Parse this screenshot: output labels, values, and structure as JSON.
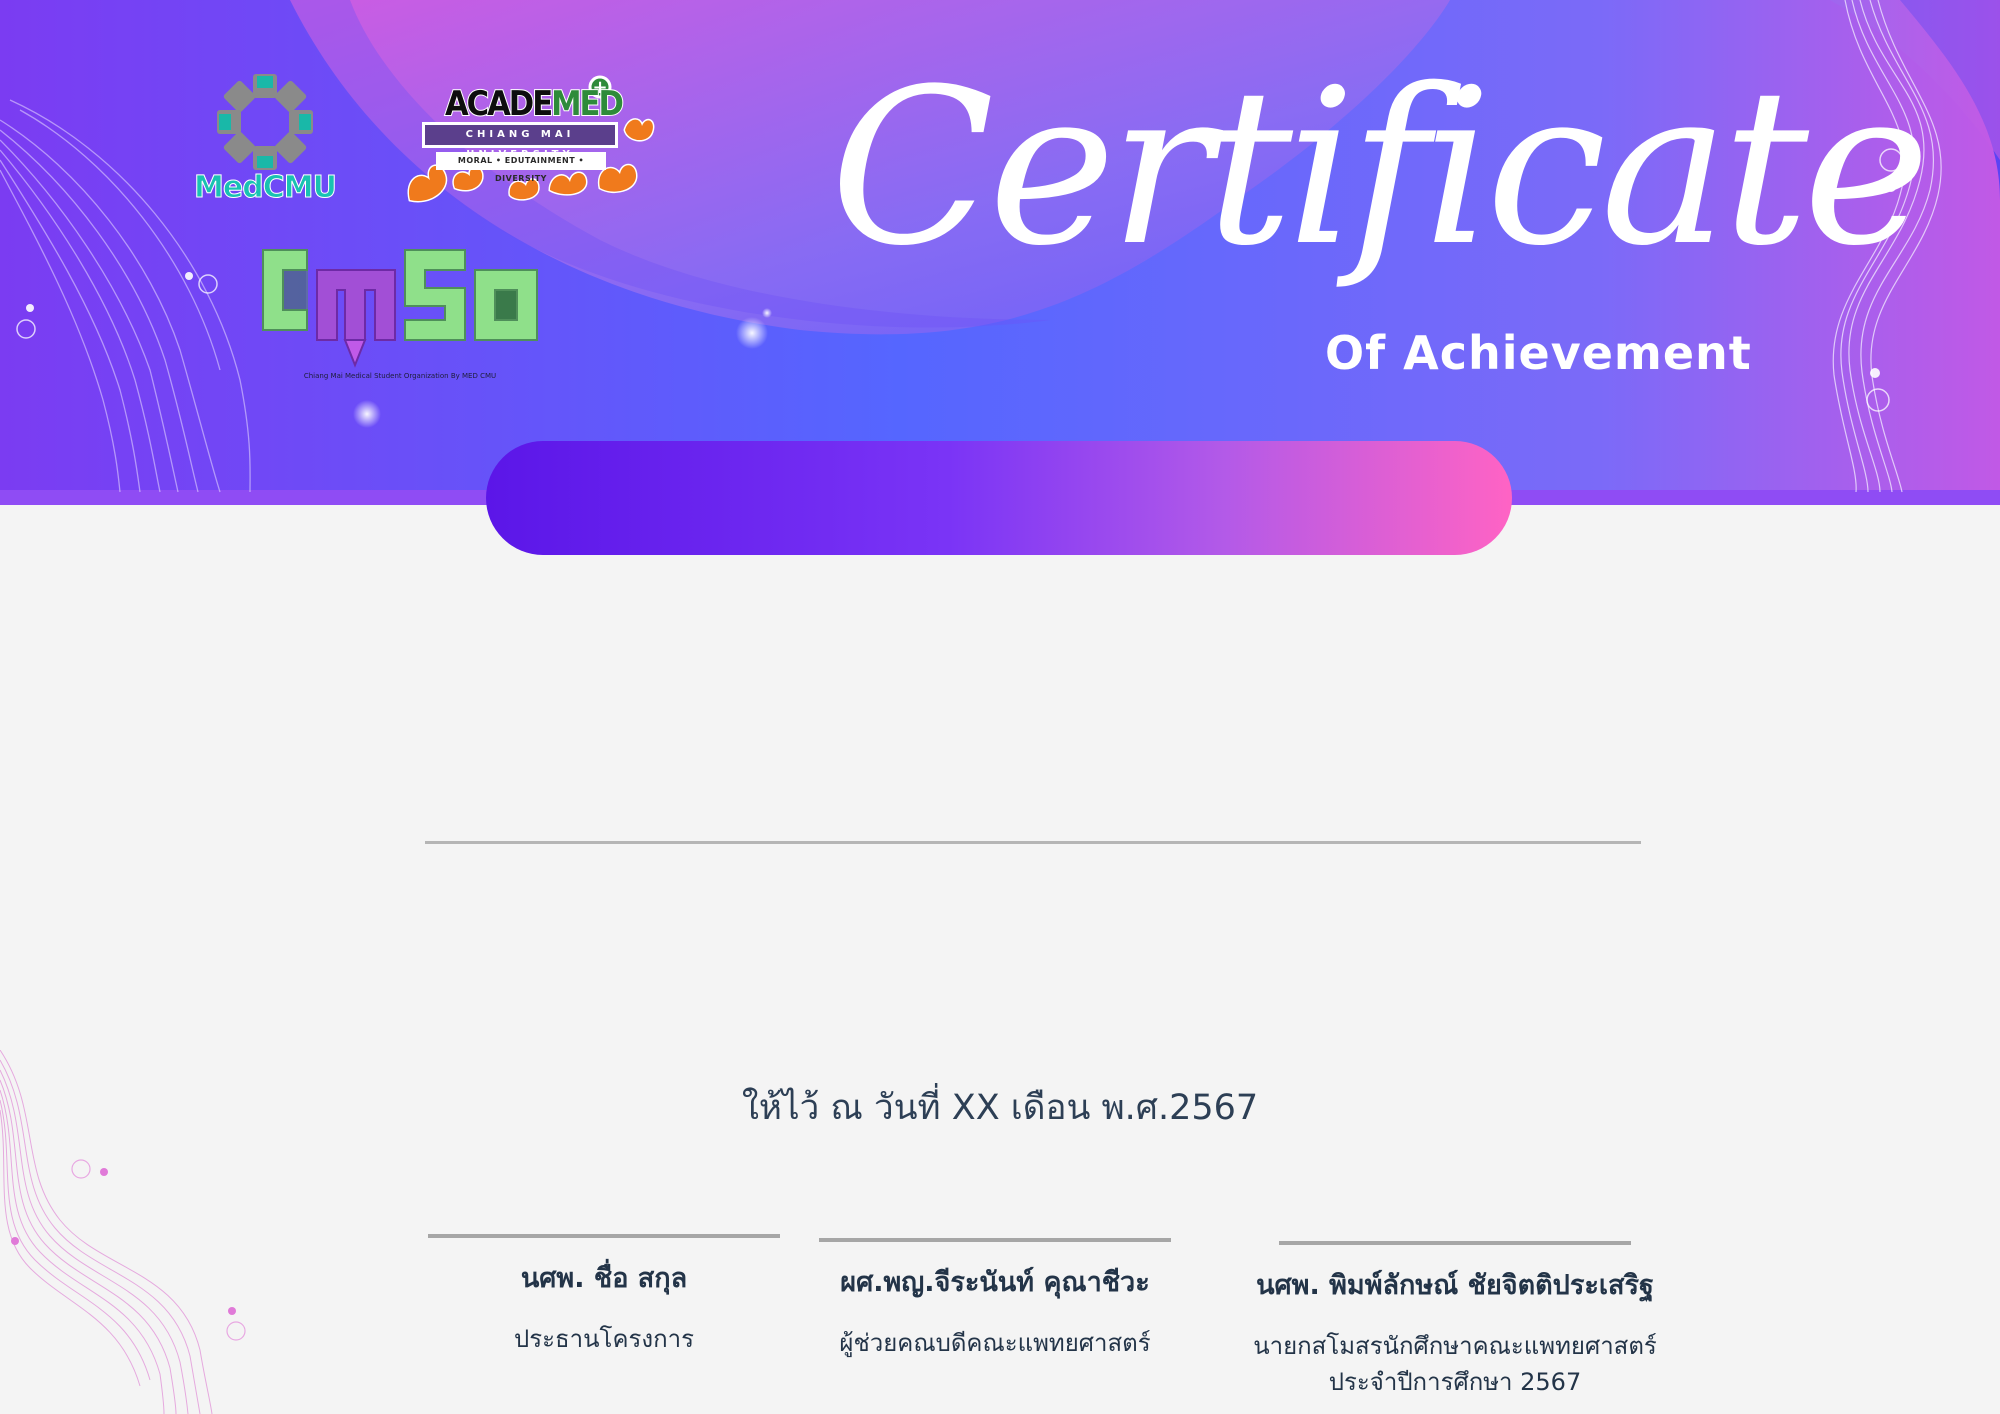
{
  "logos": {
    "medcmu": "MedCMU",
    "academed": {
      "part1": "ACADE",
      "part2": "MED",
      "plus": "+",
      "university": "CHIANG MAI UNIVERSITY",
      "tagline": "MORAL • EDUTAINMENT • DIVERSITY"
    },
    "cmso": {
      "word": "cmso",
      "caption": "Chiang Mai Medical Student Organization By MED CMU"
    }
  },
  "certificate": {
    "title": "Certificate",
    "subtitle": "Of Achievement",
    "date_line": "ให้ไว้ ณ วันที่ XX เดือน  พ.ศ.2567"
  },
  "signatories": [
    {
      "name": "นศพ. ชื่อ สกุล",
      "role": "ประธานโครงการ",
      "role2": ""
    },
    {
      "name": "ผศ.พญ.จีระนันท์  คุณาชีวะ",
      "role": "ผู้ช่วยคณบดีคณะแพทยศาสตร์",
      "role2": ""
    },
    {
      "name": "นศพ. พิมพ์ลักษณ์ ชัยจิตติประเสริฐ",
      "role": "นายกสโมสรนักศึกษาคณะแพทยศาสตร์",
      "role2": "ประจำปีการศึกษา 2567"
    }
  ],
  "colors": {
    "banner_left": "#7b3cf2",
    "banner_mid": "#5566ff",
    "banner_right": "#c159e6",
    "pill_start": "#5b16e8",
    "pill_end": "#ff63c4",
    "text_dark": "#233448"
  }
}
